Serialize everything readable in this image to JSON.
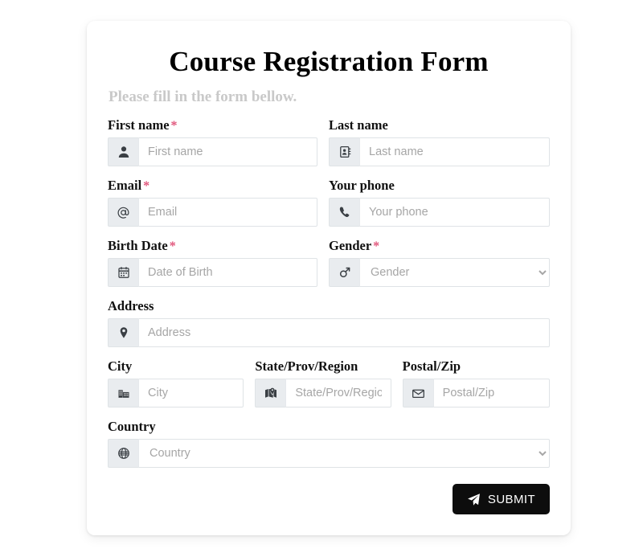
{
  "form": {
    "title": "Course Registration Form",
    "subtitle": "Please fill in the form bellow.",
    "required_marker": "*",
    "accent_required_color": "#e0547a",
    "card_background": "#ffffff",
    "page_background": "#ffffff",
    "addon_background": "#e9ecef",
    "fields": [
      {
        "name": "first_name",
        "label": "First name",
        "required": true,
        "placeholder": "First name",
        "value": "",
        "icon": "user-icon",
        "control": "text"
      },
      {
        "name": "last_name",
        "label": "Last name",
        "required": false,
        "placeholder": "Last name",
        "value": "",
        "icon": "address-book-icon",
        "control": "text"
      },
      {
        "name": "email",
        "label": "Email",
        "required": true,
        "placeholder": "Email",
        "value": "",
        "icon": "at-icon",
        "control": "text"
      },
      {
        "name": "phone",
        "label": "Your phone",
        "required": false,
        "placeholder": "Your phone",
        "value": "",
        "icon": "phone-icon",
        "control": "text"
      },
      {
        "name": "birth_date",
        "label": "Birth Date",
        "required": true,
        "placeholder": "Date of Birth",
        "value": "",
        "icon": "calendar-icon",
        "control": "text"
      },
      {
        "name": "gender",
        "label": "Gender",
        "required": true,
        "placeholder": "Gender",
        "value": "",
        "icon": "mars-gender-icon",
        "control": "select"
      },
      {
        "name": "address",
        "label": "Address",
        "required": false,
        "placeholder": "Address",
        "value": "",
        "icon": "map-pin-icon",
        "control": "text"
      },
      {
        "name": "city",
        "label": "City",
        "required": false,
        "placeholder": "City",
        "value": "",
        "icon": "city-buildings-icon",
        "control": "text"
      },
      {
        "name": "state",
        "label": "State/Prov/Region",
        "required": false,
        "placeholder": "State/Prov/Region",
        "value": "",
        "icon": "map-marked-icon",
        "control": "text"
      },
      {
        "name": "postal",
        "label": "Postal/Zip",
        "required": false,
        "placeholder": "Postal/Zip",
        "value": "",
        "icon": "envelope-icon",
        "control": "text"
      },
      {
        "name": "country",
        "label": "Country",
        "required": false,
        "placeholder": "Country",
        "value": "",
        "icon": "globe-icon",
        "control": "select"
      }
    ],
    "submit": {
      "label": "SUBMIT",
      "icon": "paper-plane-icon",
      "background": "#0d0d0d",
      "text_color": "#ffffff"
    }
  }
}
